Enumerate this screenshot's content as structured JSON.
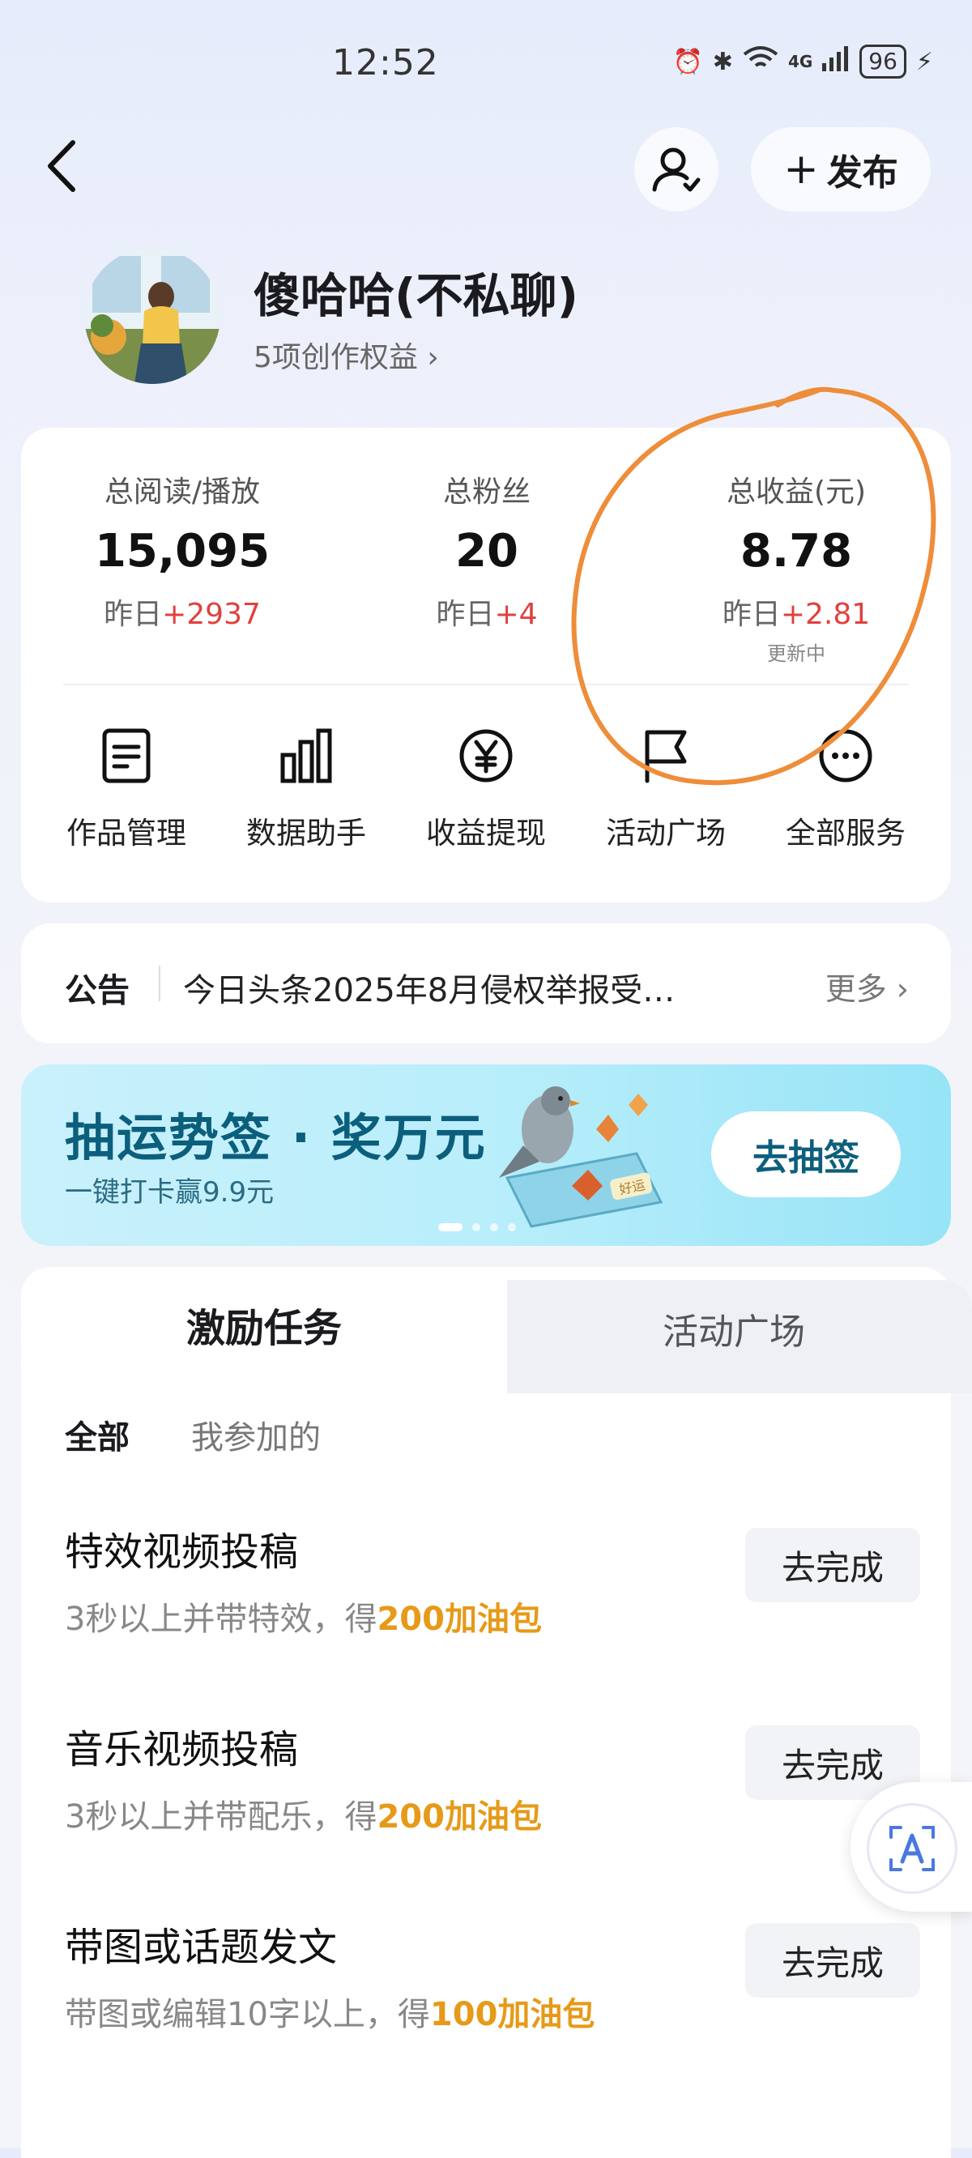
{
  "status_bar": {
    "time": "12:52",
    "battery": "96",
    "signal_label": "4G"
  },
  "header": {
    "publish_label": "发布",
    "publish_plus": "+"
  },
  "profile": {
    "name": "傻哈哈(不私聊)",
    "rights": "5项创作权益 ›"
  },
  "stats": [
    {
      "label": "总阅读/播放",
      "value": "15,095",
      "yesterday": "昨日",
      "delta": "+2937"
    },
    {
      "label": "总粉丝",
      "value": "20",
      "yesterday": "昨日",
      "delta": "+4"
    },
    {
      "label": "总收益(元)",
      "value": "8.78",
      "yesterday": "昨日",
      "delta": "+2.81",
      "note": "更新中"
    }
  ],
  "services": [
    {
      "label": "作品管理",
      "icon": "document-icon"
    },
    {
      "label": "数据助手",
      "icon": "bar-chart-icon"
    },
    {
      "label": "收益提现",
      "icon": "yuan-icon"
    },
    {
      "label": "活动广场",
      "icon": "flag-icon"
    },
    {
      "label": "全部服务",
      "icon": "more-icon"
    }
  ],
  "notice": {
    "title": "公告",
    "text": "今日头条2025年8月侵权举报受…",
    "more": "更多 ›"
  },
  "banner": {
    "title": "抽运势签 · 奖万元",
    "subtitle": "一键打卡赢9.9元",
    "button": "去抽签",
    "tag": "好运"
  },
  "tabs": {
    "active": "激励任务",
    "inactive": "活动广场"
  },
  "filters": {
    "all": "全部",
    "mine": "我参加的"
  },
  "tasks": [
    {
      "title": "特效视频投稿",
      "desc": "3秒以上并带特效，得",
      "reward": "200加油包",
      "button": "去完成"
    },
    {
      "title": "音乐视频投稿",
      "desc": "3秒以上并带配乐，得",
      "reward": "200加油包",
      "button": "去完成"
    },
    {
      "title": "带图或话题发文",
      "desc": "带图或编辑10字以上，得",
      "reward": "100加油包",
      "button": "去完成"
    }
  ],
  "colors": {
    "accent_red": "#e0413e",
    "reward_orange": "#e69a18",
    "banner_text": "#0c5f7c",
    "annotation_orange": "#ee8d3a"
  }
}
